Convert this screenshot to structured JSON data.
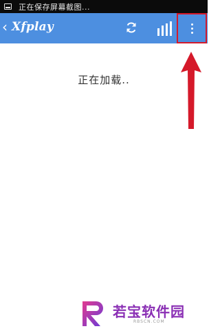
{
  "status_bar": {
    "text": "正在保存屏幕截图..."
  },
  "app_bar": {
    "back_icon": "chevron-left-icon",
    "title": "Xfplay",
    "refresh_icon": "refresh-icon",
    "stats_icon": "bar-chart-icon",
    "menu_icon": "more-vertical-icon",
    "color": "#4d8fe0"
  },
  "content": {
    "loading_text": "正在加载.."
  },
  "annotation": {
    "highlight_color": "#d5192a"
  },
  "watermark": {
    "title": "若宝软件园",
    "url": "RBSCN.COM",
    "color": "#8a2fb4"
  }
}
